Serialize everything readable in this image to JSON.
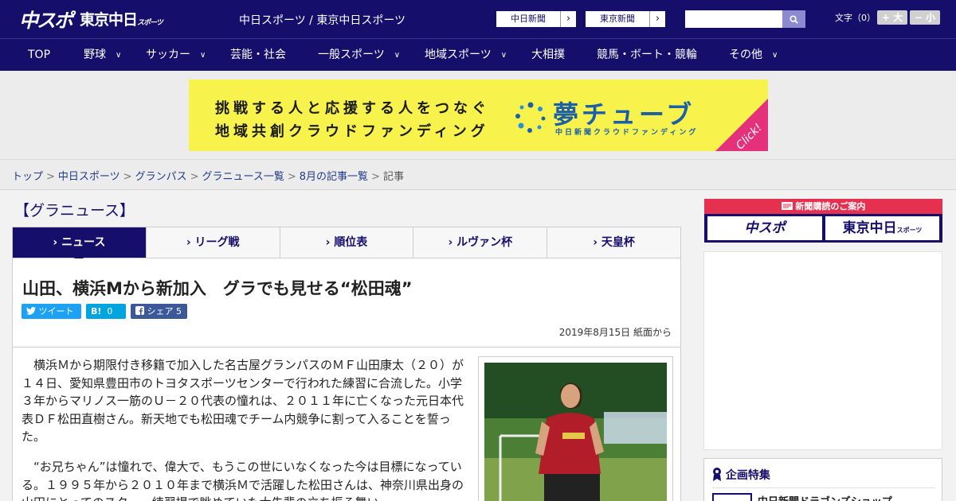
{
  "header": {
    "logo_main": "中スポ",
    "logo_tokyo": "東京中日",
    "logo_tokyo_small": "スポーツ",
    "site_name": "中日スポーツ / 東京中日スポーツ",
    "paper_links": [
      {
        "label": "中日新聞",
        "arrow": "›"
      },
      {
        "label": "東京新聞",
        "arrow": "›"
      }
    ],
    "search": {
      "placeholder": "",
      "button_icon": "search-icon"
    },
    "font_size": {
      "label": "文字（0）",
      "increase": "+ 大",
      "decrease": "− 小"
    }
  },
  "nav": {
    "items": [
      {
        "label": "TOP",
        "has_menu": false
      },
      {
        "label": "野球",
        "has_menu": true
      },
      {
        "label": "サッカー",
        "has_menu": true
      },
      {
        "label": "芸能・社会",
        "has_menu": false
      },
      {
        "label": "一般スポーツ",
        "has_menu": true
      },
      {
        "label": "地域スポーツ",
        "has_menu": true
      },
      {
        "label": "大相撲",
        "has_menu": false
      },
      {
        "label": "競馬・ボート・競輪",
        "has_menu": false
      },
      {
        "label": "その他",
        "has_menu": true
      }
    ],
    "chevron": "∨"
  },
  "banner": {
    "line1": "挑戦する人と応援する人をつなぐ",
    "line2": "地域共創クラウドファンディング",
    "brand": "夢チューブ",
    "brand_sub": "中日新聞クラウドファンディング",
    "click": "Click!"
  },
  "breadcrumbs": {
    "items": [
      "トップ",
      "中日スポーツ",
      "グランパス",
      "グラニュース一覧",
      "8月の記事一覧"
    ],
    "current": "記事",
    "separator": ">"
  },
  "section": {
    "title": "【グラニュース】"
  },
  "tabs": [
    {
      "label": "ニュース",
      "active": true
    },
    {
      "label": "リーグ戦",
      "active": false
    },
    {
      "label": "順位表",
      "active": false
    },
    {
      "label": "ルヴァン杯",
      "active": false
    },
    {
      "label": "天皇杯",
      "active": false
    }
  ],
  "tab_marker": "›",
  "article": {
    "headline": "山田、横浜Mから新加入　グラでも見せる“松田魂”",
    "share": {
      "tweet": "ツイート",
      "hatena_icon": "B!",
      "hatena_count": "0",
      "facebook": "シェア",
      "facebook_count": "5"
    },
    "date": "2019年8月15日 紙面から",
    "paragraphs": [
      "横浜Ｍから期限付き移籍で加入した名古屋グランパスのＭＦ山田康太（２０）が１４日、愛知県豊田市のトヨタスポーツセンターで行われた練習に合流した。小学３年からマリノス一筋のＵ－２０代表の憧れは、２０１１年に亡くなった元日本代表ＤＦ松田直樹さん。新天地でも松田魂でチーム内競争に割って入ることを誓った。",
      "“お兄ちゃん”は憧れで、偉大で、もうこの世にいなくなった今は目標になっている。１９９５年から２０１０年まで横浜Ｍで活躍した松田さんは、神奈川県出身の山田にとってのスター。練習場で眺めていた大先輩の立ち振る舞い"
    ]
  },
  "sidebar": {
    "subscribe_head": "新聞購読のご案内",
    "subscribe_logos": [
      "中スポ",
      "東京中日"
    ],
    "subscribe_logo_small": "スポーツ",
    "special_title": "企画特集",
    "special_item": "中日新聞ドラゴンズショップ"
  },
  "colors": {
    "navy": "#160e6b",
    "accent_pink": "#e5307c",
    "banner_yellow": "#f7f34c",
    "twitter": "#1da1f2",
    "hatena": "#00a4de",
    "facebook": "#3b5998"
  }
}
